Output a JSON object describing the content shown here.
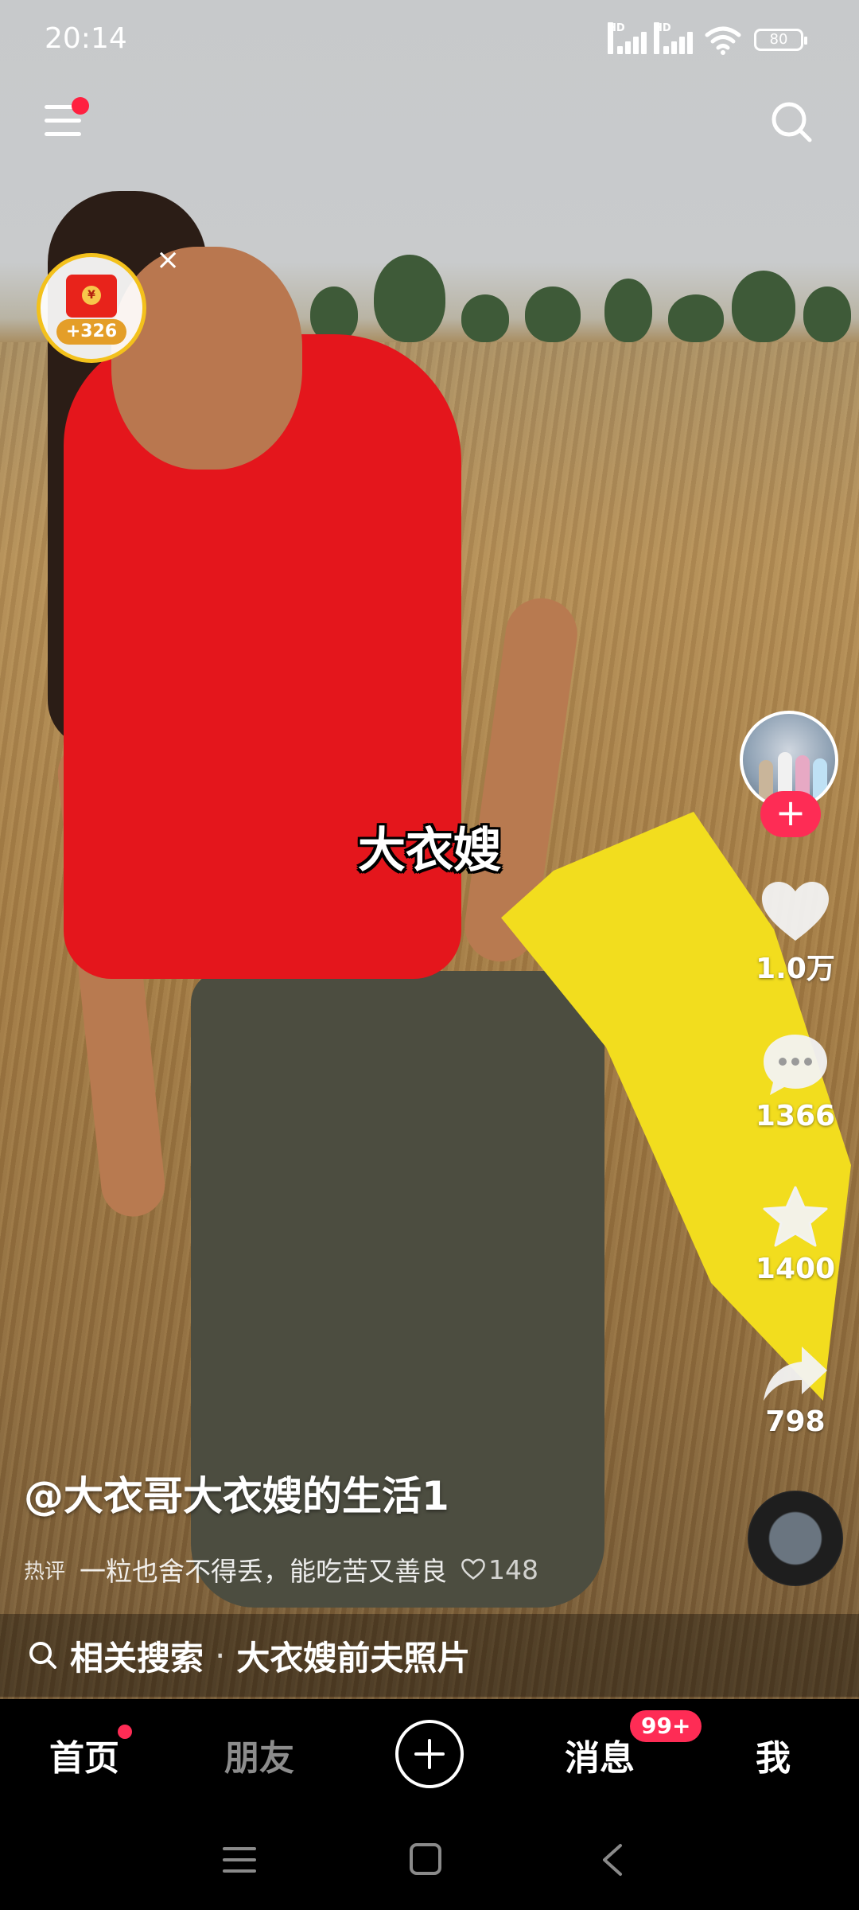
{
  "status_bar": {
    "time": "20:14",
    "signal_label_1": "HD",
    "signal_label_2": "HD",
    "battery": "80"
  },
  "top_bar": {
    "menu_icon": "menu-icon",
    "search_icon": "search-icon"
  },
  "reward_widget": {
    "amount": "+326",
    "coin": "¥",
    "close": "×"
  },
  "video": {
    "subtitle": "大衣嫂"
  },
  "actions": {
    "follow": "+",
    "likes": "1.0万",
    "comments": "1366",
    "favorites": "1400",
    "shares": "798"
  },
  "post": {
    "author": "@大衣哥大衣嫂的生活1",
    "hot_comment_tag": "热评",
    "hot_comment_text": "一粒也舍不得丢，能吃苦又善良",
    "hot_comment_likes": "148"
  },
  "related_search": {
    "label": "相关搜索",
    "separator": "·",
    "query": "大衣嫂前夫照片"
  },
  "bottom_nav": {
    "home": "首页",
    "friends": "朋友",
    "messages": "消息",
    "messages_badge": "99+",
    "me": "我"
  },
  "colors": {
    "accent": "#fe2c55",
    "nav_bg": "#000000",
    "reward_ring": "#f3c11c"
  }
}
